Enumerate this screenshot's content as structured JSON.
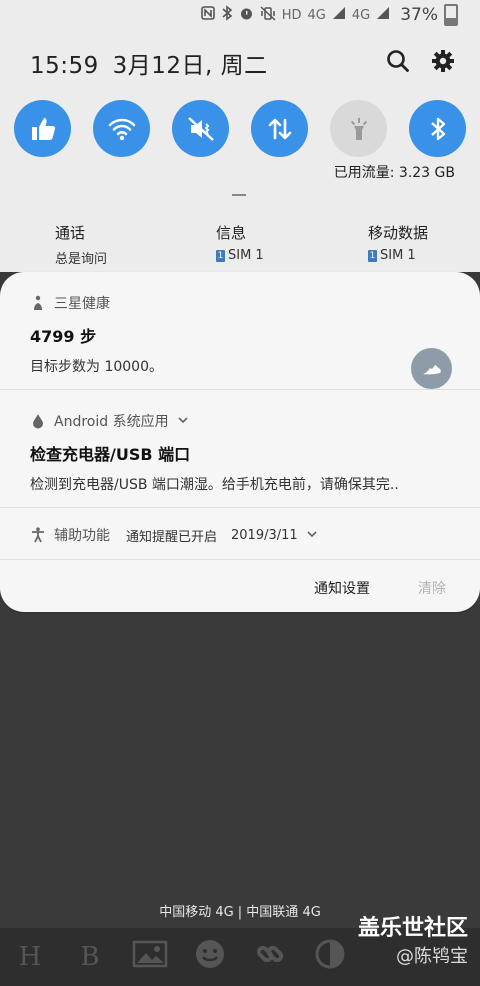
{
  "status_bar": {
    "hd": "HD",
    "sig1_label": "4G",
    "sig2_label": "4G",
    "battery_percent": "37%",
    "battery_level": 0.37
  },
  "header": {
    "time": "15:59",
    "date": "3月12日, 周二",
    "search_icon": "search-icon",
    "settings_icon": "gear-icon"
  },
  "quick_settings": {
    "tiles": [
      {
        "icon": "thumbs-up-icon",
        "active": true
      },
      {
        "icon": "wifi-icon",
        "active": true
      },
      {
        "icon": "vibrate-icon",
        "active": true
      },
      {
        "icon": "mobile-data-icon",
        "active": true
      },
      {
        "icon": "flashlight-icon",
        "active": false
      },
      {
        "icon": "bluetooth-icon",
        "active": true
      }
    ],
    "data_usage": "已用流量: 3.23 GB"
  },
  "sim_settings": [
    {
      "title": "通话",
      "sub": "总是询问",
      "badge": ""
    },
    {
      "title": "信息",
      "sub": "SIM 1",
      "badge": "1"
    },
    {
      "title": "移动数据",
      "sub": "SIM 1",
      "badge": "1"
    }
  ],
  "notifications": {
    "health": {
      "app": "三星健康",
      "title": "4799 步",
      "body": "目标步数为 10000。"
    },
    "android": {
      "app": "Android 系统应用",
      "title": "检查充电器/USB 端口",
      "body": "检测到充电器/USB 端口潮湿。给手机充电前，请确保其完.."
    },
    "accessibility": {
      "app": "辅助功能",
      "status": "通知提醒已开启",
      "date": "2019/3/11"
    },
    "actions": {
      "settings": "通知设置",
      "clear": "清除"
    }
  },
  "carrier_text": "中国移动 4G | 中国联通 4G",
  "toolbar": {
    "h": "H",
    "b": "B"
  },
  "watermark": {
    "site": "盖乐世社区",
    "user": "@陈鸨宝"
  }
}
